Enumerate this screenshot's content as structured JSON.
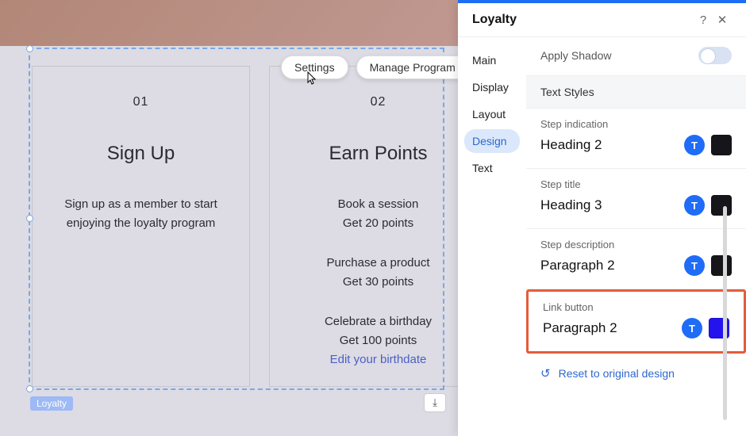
{
  "toolbar": {
    "settings_label": "Settings",
    "manage_label": "Manage Program"
  },
  "canvas": {
    "element_tag": "Loyalty",
    "cards": [
      {
        "num": "01",
        "title": "Sign Up",
        "lines": [
          "Sign up as a member to start",
          "enjoying the loyalty program"
        ]
      },
      {
        "num": "02",
        "title": "Earn Points",
        "lines": [
          "Book a session",
          "Get 20 points"
        ],
        "lines2": [
          "Purchase a product",
          "Get 30 points"
        ],
        "lines3": [
          "Celebrate a birthday",
          "Get 100 points"
        ],
        "link": "Edit your birthdate"
      }
    ]
  },
  "panel": {
    "title": "Loyalty",
    "nav": {
      "main": "Main",
      "display": "Display",
      "layout": "Layout",
      "design": "Design",
      "text": "Text"
    },
    "shadow_label": "Apply Shadow",
    "section_header": "Text Styles",
    "styles": [
      {
        "caption": "Step indication",
        "value": "Heading 2",
        "color": "#16161a"
      },
      {
        "caption": "Step title",
        "value": "Heading 3",
        "color": "#16161a"
      },
      {
        "caption": "Step description",
        "value": "Paragraph 2",
        "color": "#16161a"
      },
      {
        "caption": "Link button",
        "value": "Paragraph 2",
        "color": "#2314ee"
      }
    ],
    "reset_label": "Reset to original design"
  }
}
